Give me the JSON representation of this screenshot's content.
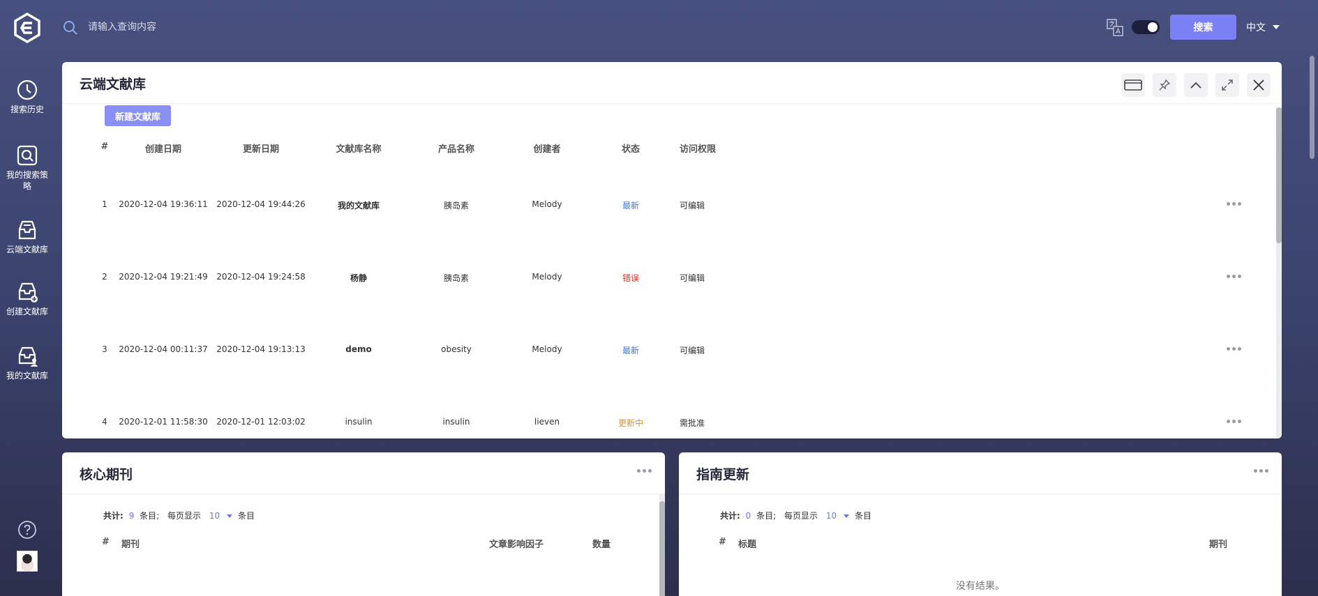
{
  "sidebar": {
    "items": [
      {
        "label": "搜索历史",
        "icon": "clock-icon"
      },
      {
        "label": "我的搜索策略",
        "icon": "search-strategy-icon"
      },
      {
        "label": "云端文献库",
        "icon": "inbox-icon"
      },
      {
        "label": "创建文献库",
        "icon": "create-library-icon"
      },
      {
        "label": "我的文献库",
        "icon": "my-library-icon"
      }
    ]
  },
  "topbar": {
    "search_placeholder": "请输入查询内容",
    "search_button": "搜索",
    "language": "中文"
  },
  "library_panel": {
    "title": "云端文献库",
    "new_button": "新建文献库",
    "columns": {
      "index": "#",
      "created": "创建日期",
      "updated": "更新日期",
      "name": "文献库名称",
      "product": "产品名称",
      "creator": "创建者",
      "status": "状态",
      "access": "访问权限"
    },
    "rows": [
      {
        "index": "1",
        "created": "2020-12-04 19:36:11",
        "updated": "2020-12-04 19:44:26",
        "name": "我的文献库",
        "product": "胰岛素",
        "creator": "Melody",
        "status": "最新",
        "status_color": "#3b7ddd",
        "access": "可编辑"
      },
      {
        "index": "2",
        "created": "2020-12-04 19:21:49",
        "updated": "2020-12-04 19:24:58",
        "name": "杨静",
        "product": "胰岛素",
        "creator": "Melody",
        "status": "错误",
        "status_color": "#d93025",
        "access": "可编辑"
      },
      {
        "index": "3",
        "created": "2020-12-04 00:11:37",
        "updated": "2020-12-04 19:13:13",
        "name": "demo",
        "product": "obesity",
        "creator": "Melody",
        "status": "最新",
        "status_color": "#3b7ddd",
        "access": "可编辑"
      },
      {
        "index": "4",
        "created": "2020-12-01 11:58:30",
        "updated": "2020-12-01 12:03:02",
        "name": "insulin",
        "product": "insulin",
        "creator": "lieven",
        "status": "更新中",
        "status_color": "#e8900c",
        "access": "需批准"
      }
    ]
  },
  "journal_panel": {
    "title": "核心期刊",
    "total_label": "共计:",
    "total_count": "9",
    "items_unit": "条目;",
    "per_page_label": "每页显示",
    "per_page_value": "10",
    "per_page_unit": "条目",
    "columns": {
      "index": "#",
      "journal": "期刊",
      "impact": "文章影响因子",
      "count": "数量"
    }
  },
  "guide_panel": {
    "title": "指南更新",
    "total_label": "共计:",
    "total_count": "0",
    "items_unit": "条目;",
    "per_page_label": "每页显示",
    "per_page_value": "10",
    "per_page_unit": "条目",
    "columns": {
      "index": "#",
      "title": "标题",
      "journal": "期刊"
    },
    "empty_text": "没有结果。"
  }
}
